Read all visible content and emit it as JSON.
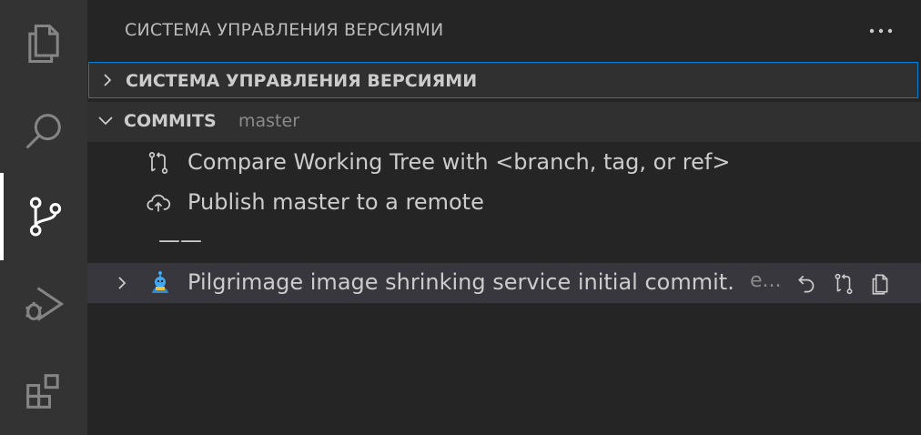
{
  "sidebar": {
    "title": "СИСТЕМА УПРАВЛЕНИЯ ВЕРСИЯМИ",
    "more_actions_label": "···"
  },
  "sections": {
    "scm": {
      "title": "СИСТЕМА УПРАВЛЕНИЯ ВЕРСИЯМИ",
      "expanded": false
    },
    "commits": {
      "title": "COMMITS",
      "branch": "master",
      "expanded": true,
      "items": [
        {
          "label": "Compare Working Tree with <branch, tag, or ref>",
          "icon": "compare-icon"
        },
        {
          "label": "Publish master to a remote",
          "icon": "cloud-upload-icon"
        }
      ],
      "separator": "——",
      "commit": {
        "message": "Pilgrimage image shrinking service initial commit.",
        "description_truncated": "e...",
        "avatar": "avatar-icon"
      }
    }
  },
  "colors": {
    "activity_bar": "#333333",
    "sidebar_bg": "#252526",
    "focus_border": "#007fd4",
    "selected_row": "#37373d"
  }
}
